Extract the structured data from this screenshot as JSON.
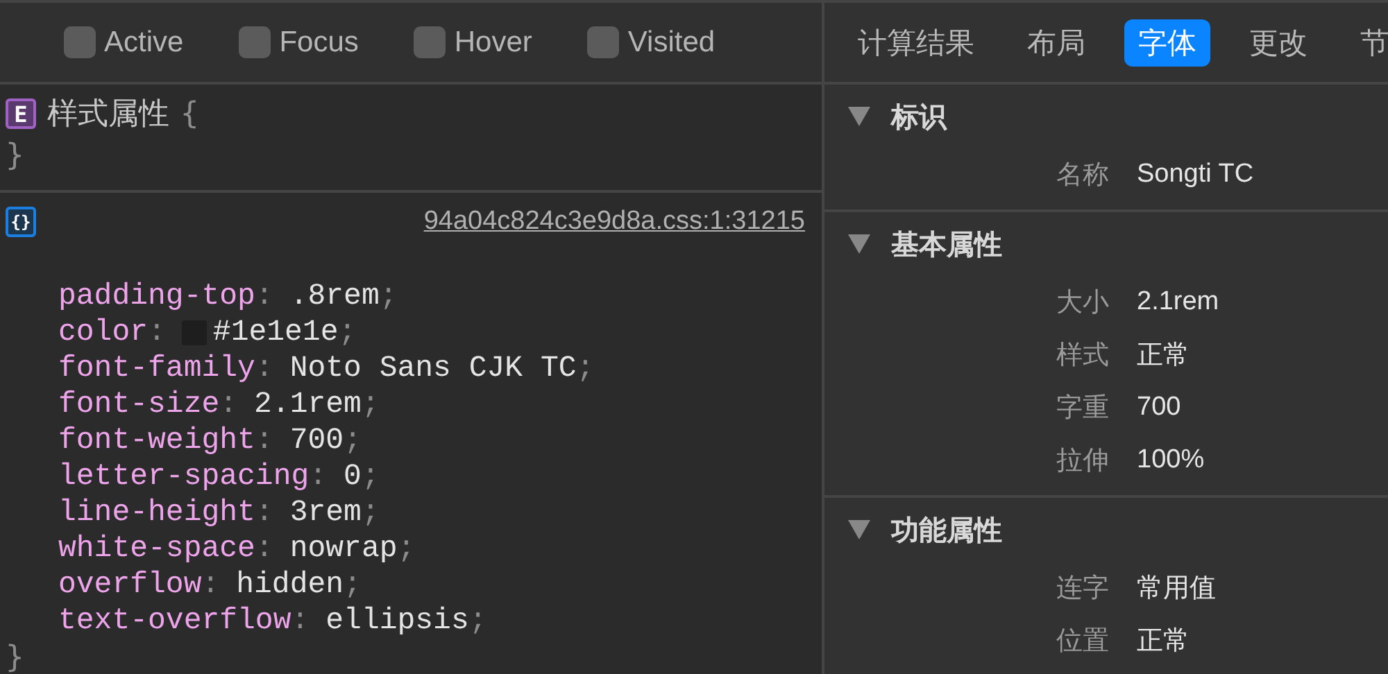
{
  "pseudo_classes": [
    {
      "label": "Active",
      "checked": false
    },
    {
      "label": "Focus",
      "checked": false
    },
    {
      "label": "Hover",
      "checked": false
    },
    {
      "label": "Visited",
      "checked": false
    }
  ],
  "rules": [
    {
      "kind": "element",
      "badge": "E",
      "selector": "样式属性",
      "open_brace": "{",
      "close_brace": "}"
    },
    {
      "kind": "stylesheet",
      "badge": "{}",
      "source_link": "94a04c824c3e9d8a.css:1:31215",
      "declarations": [
        {
          "property": "padding-top",
          "colon": ":",
          "value": ".8rem",
          "semicolon": ";"
        },
        {
          "property": "color",
          "colon": ":",
          "value": "#1e1e1e",
          "semicolon": ";",
          "color": "#1e1e1e"
        },
        {
          "property": "font-family",
          "colon": ":",
          "value": "Noto Sans CJK TC",
          "semicolon": ";"
        },
        {
          "property": "font-size",
          "colon": ":",
          "value": "2.1rem",
          "semicolon": ";"
        },
        {
          "property": "font-weight",
          "colon": ":",
          "value": "700",
          "semicolon": ";"
        },
        {
          "property": "letter-spacing",
          "colon": ":",
          "value": "0",
          "semicolon": ";"
        },
        {
          "property": "line-height",
          "colon": ":",
          "value": "3rem",
          "semicolon": ";"
        },
        {
          "property": "white-space",
          "colon": ":",
          "value": "nowrap",
          "semicolon": ";"
        },
        {
          "property": "overflow",
          "colon": ":",
          "value": "hidden",
          "semicolon": ";"
        },
        {
          "property": "text-overflow",
          "colon": ":",
          "value": "ellipsis",
          "semicolon": ";"
        }
      ],
      "close_brace": "}"
    }
  ],
  "details_tabs": [
    {
      "label": "计算结果",
      "selected": false
    },
    {
      "label": "布局",
      "selected": false
    },
    {
      "label": "字体",
      "selected": true
    },
    {
      "label": "更改",
      "selected": false
    },
    {
      "label": "节",
      "selected": false
    }
  ],
  "sections": [
    {
      "title": "标识",
      "expanded": true,
      "rows": [
        {
          "label": "名称",
          "value": "Songti TC"
        }
      ]
    },
    {
      "title": "基本属性",
      "expanded": true,
      "rows": [
        {
          "label": "大小",
          "value": "2.1rem"
        },
        {
          "label": "样式",
          "value": "正常"
        },
        {
          "label": "字重",
          "value": "700"
        },
        {
          "label": "拉伸",
          "value": "100%"
        }
      ]
    },
    {
      "title": "功能属性",
      "expanded": true,
      "rows": [
        {
          "label": "连字",
          "value": "常用值"
        },
        {
          "label": "位置",
          "value": "正常"
        }
      ]
    }
  ]
}
